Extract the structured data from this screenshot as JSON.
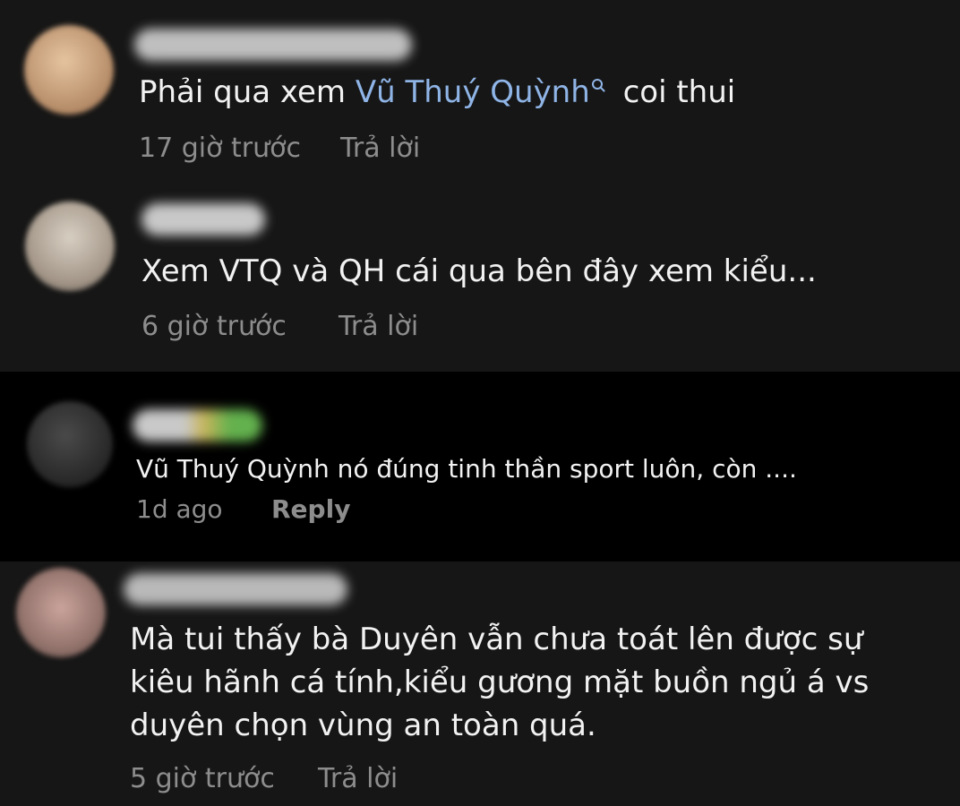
{
  "comments": [
    {
      "text_parts": [
        "Phải qua xem ",
        "Vũ Thuý Quỳnh",
        " coi thui"
      ],
      "time": "17 giờ trước",
      "reply": "Trả lời"
    },
    {
      "text": "Xem VTQ và QH cái qua bên đây xem kiểu...",
      "time": "6 giờ trước",
      "reply": "Trả lời"
    },
    {
      "text": "Vũ Thuý Quỳnh nó đúng tinh thần sport luôn, còn ....",
      "time": "1d ago",
      "reply": "Reply"
    },
    {
      "lines": [
        "Mà tui thấy bà Duyên vẫn chưa toát lên được sự",
        "kiêu hãnh cá tính,kiểu gương mặt buồn ngủ á vs",
        "duyên chọn vùng an toàn quá."
      ],
      "time": "5 giờ trước",
      "reply": "Trả lời"
    }
  ],
  "colors": {
    "background": "#161616",
    "highlight_background": "#000000",
    "text": "#f2f2f2",
    "meta": "#8d8d8d",
    "mention": "#8fb4e6"
  }
}
